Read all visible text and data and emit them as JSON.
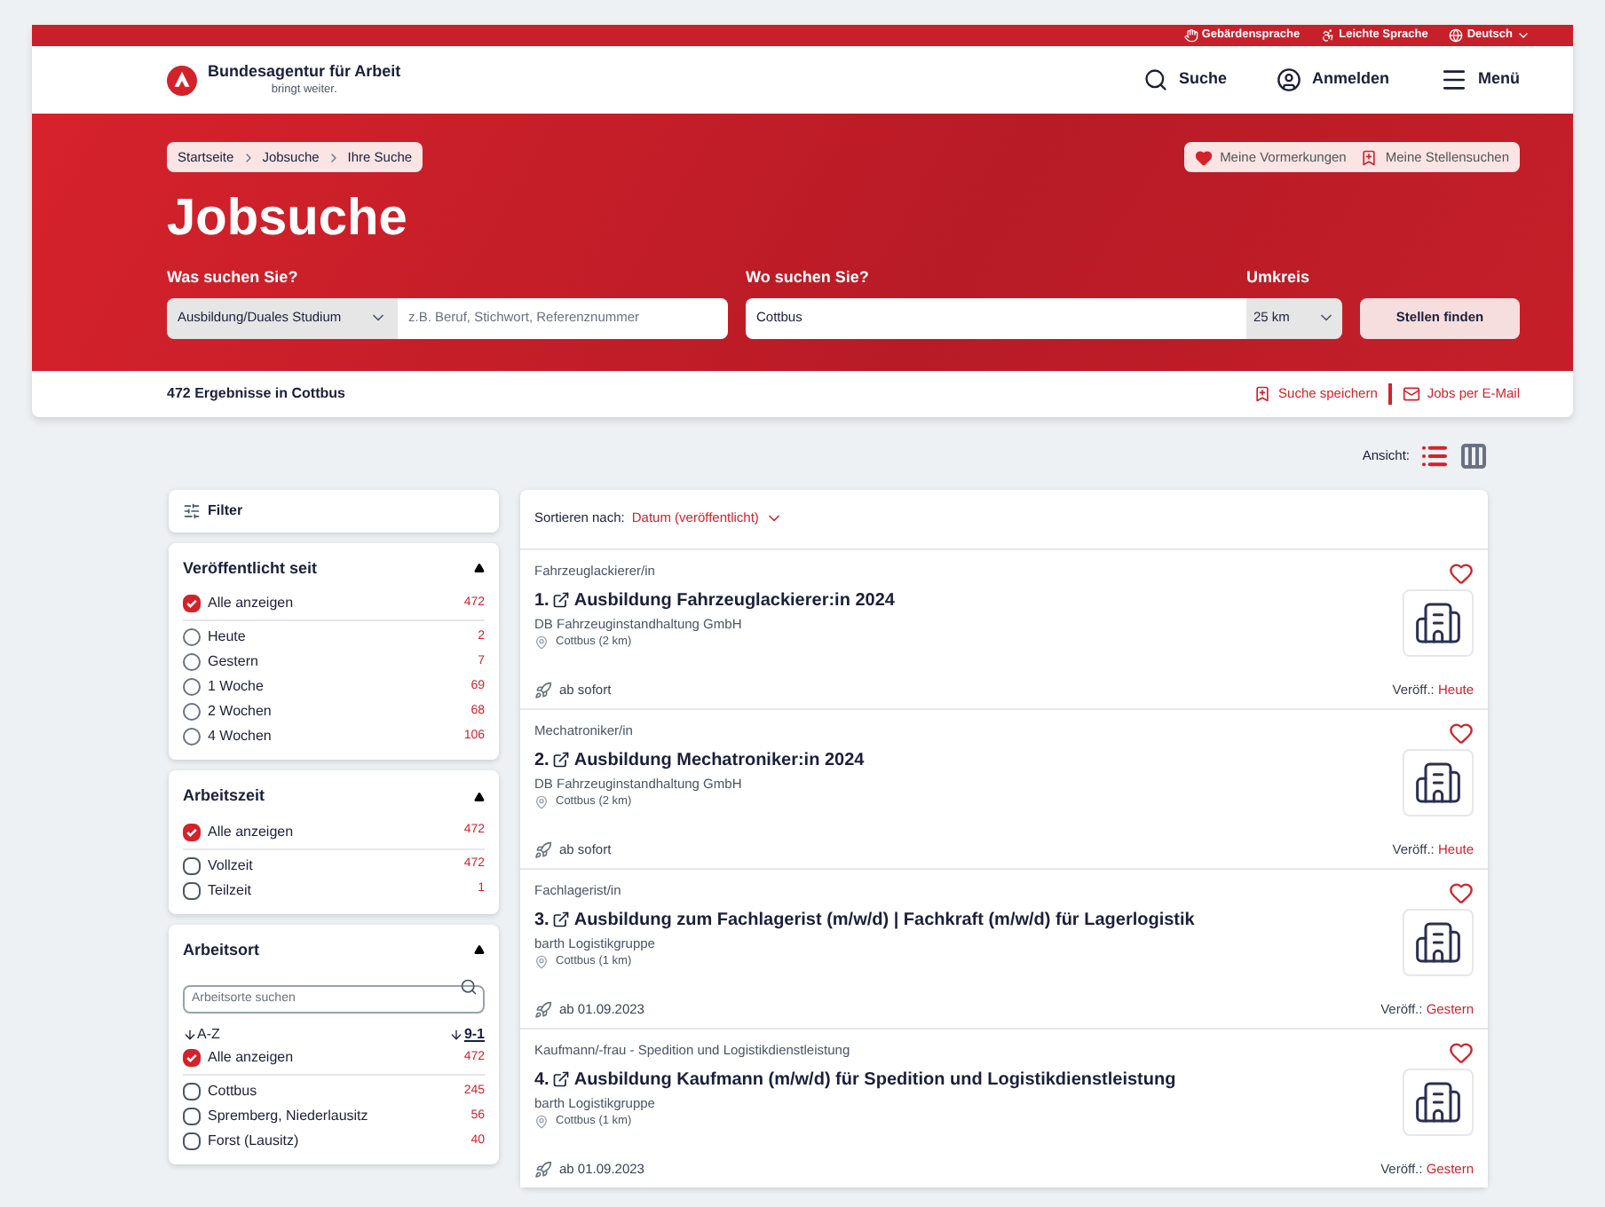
{
  "top_bar": {
    "links": [
      {
        "kind": "hand",
        "label": "Gebärdensprache"
      },
      {
        "kind": "easy",
        "label": "Leichte Sprache"
      },
      {
        "kind": "language",
        "label": "Deutsch"
      }
    ]
  },
  "header": {
    "logo_name": "Bundesagentur für Arbeit",
    "logo_tagline": "bringt weiter.",
    "actions": [
      {
        "kind": "search",
        "label": "Suche"
      },
      {
        "kind": "user",
        "label": "Anmelden"
      },
      {
        "kind": "menu",
        "label": "Menü"
      }
    ]
  },
  "hero": {
    "breadcrumbs": [
      "Startseite",
      "Jobsuche",
      "Ihre Suche"
    ],
    "quick_links": [
      {
        "kind": "heart",
        "label": "Meine Vormerkungen"
      },
      {
        "kind": "saved",
        "label": "Meine Stellensuchen"
      }
    ],
    "title": "Jobsuche",
    "what": {
      "label": "Was suchen Sie?",
      "category": "Ausbildung/Duales Studium",
      "placeholder": "z.B. Beruf, Stichwort, Referenznummer"
    },
    "where": {
      "label": "Wo suchen Sie?",
      "value": "Cottbus"
    },
    "radius": {
      "label": "Umkreis",
      "value": "25 km"
    },
    "submit": "Stellen finden"
  },
  "results_bar": {
    "count": "472 Ergebnisse in Cottbus",
    "actions": [
      {
        "kind": "saved",
        "label": "Suche speichern"
      },
      {
        "kind": "mail",
        "label": "Jobs per E-Mail"
      }
    ]
  },
  "view": {
    "label": "Ansicht:",
    "options": [
      {
        "kind": "list",
        "selected": true
      },
      {
        "kind": "columns",
        "selected": false
      }
    ]
  },
  "filter_title": "Filter",
  "filter_groups": [
    {
      "title": "Veröffentlicht seit",
      "expanded": true,
      "options": [
        {
          "kind": "checkbox",
          "label": "Alle anzeigen",
          "count": "472",
          "checked": true
        },
        {
          "kind": "radio",
          "label": "Heute",
          "count": "2",
          "checked": false
        },
        {
          "kind": "radio",
          "label": "Gestern",
          "count": "7",
          "checked": false
        },
        {
          "kind": "radio",
          "label": "1 Woche",
          "count": "69",
          "checked": false
        },
        {
          "kind": "radio",
          "label": "2 Wochen",
          "count": "68",
          "checked": false
        },
        {
          "kind": "radio",
          "label": "4 Wochen",
          "count": "106",
          "checked": false
        }
      ]
    },
    {
      "title": "Arbeitszeit",
      "expanded": true,
      "options": [
        {
          "kind": "checkbox",
          "label": "Alle anzeigen",
          "count": "472",
          "checked": true
        },
        {
          "kind": "checkbox",
          "label": "Vollzeit",
          "count": "472",
          "checked": false
        },
        {
          "kind": "checkbox",
          "label": "Teilzeit",
          "count": "1",
          "checked": false
        }
      ]
    },
    {
      "title": "Arbeitsort",
      "expanded": true,
      "search_placeholder": "Arbeitsorte suchen",
      "sort_options": [
        {
          "label": "A-Z",
          "selected": false
        },
        {
          "label": "9-1",
          "selected": true
        }
      ],
      "options": [
        {
          "kind": "checkbox",
          "label": "Alle anzeigen",
          "count": "472",
          "checked": true
        },
        {
          "kind": "checkbox",
          "label": "Cottbus",
          "count": "245",
          "checked": false
        },
        {
          "kind": "checkbox",
          "label": "Spremberg, Niederlausitz",
          "count": "56",
          "checked": false
        },
        {
          "kind": "checkbox",
          "label": "Forst (Lausitz)",
          "count": "40",
          "checked": false
        }
      ]
    }
  ],
  "sort": {
    "label": "Sortieren nach:",
    "value": "Datum (veröffentlicht)"
  },
  "jobs": [
    {
      "category": "Fahrzeuglackierer/in",
      "number": "1.",
      "title": "Ausbildung Fahrzeuglackierer:in 2024",
      "employer": "DB Fahrzeuginstandhaltung GmbH",
      "location": "Cottbus (2 km)",
      "start": "ab sofort",
      "published_label": "Veröff.:",
      "published": "Heute",
      "saved": false
    },
    {
      "category": "Mechatroniker/in",
      "number": "2.",
      "title": "Ausbildung Mechatroniker:in 2024",
      "employer": "DB Fahrzeuginstandhaltung GmbH",
      "location": "Cottbus (2 km)",
      "start": "ab sofort",
      "published_label": "Veröff.:",
      "published": "Heute",
      "saved": false
    },
    {
      "category": "Fachlagerist/in",
      "number": "3.",
      "title": "Ausbildung zum Fachlagerist (m/w/d) | Fachkraft (m/w/d) für Lagerlogistik",
      "employer": "barth Logistikgruppe",
      "location": "Cottbus (1 km)",
      "start": "ab 01.09.2023",
      "published_label": "Veröff.:",
      "published": "Gestern",
      "saved": false
    },
    {
      "category": "Kaufmann/-frau - Spedition und Logistikdienstleistung",
      "number": "4.",
      "title": "Ausbildung Kaufmann (m/w/d) für Spedition und Logistikdienstleistung",
      "employer": "barth Logistikgruppe",
      "location": "Cottbus (1 km)",
      "start": "ab 01.09.2023",
      "published_label": "Veröff.:",
      "published": "Gestern",
      "saved": false
    }
  ]
}
